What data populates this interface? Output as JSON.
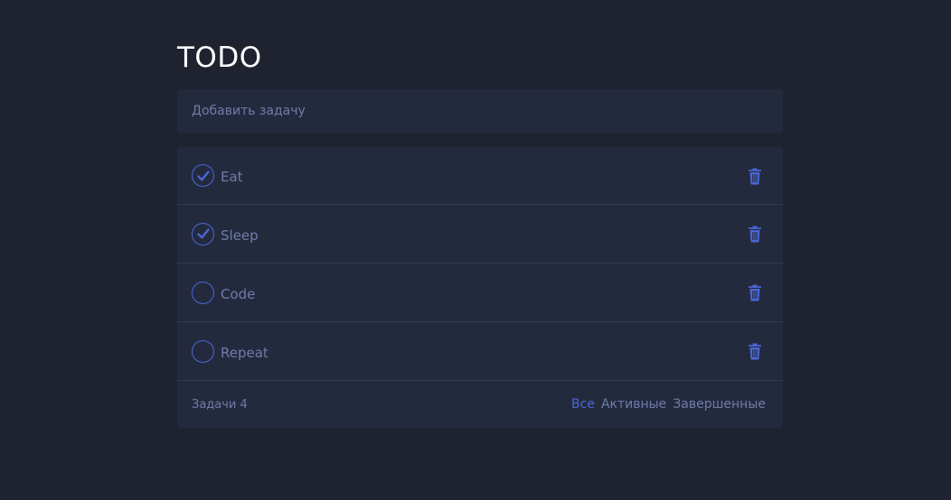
{
  "header": {
    "title": "TODO"
  },
  "new_task": {
    "placeholder": "Добавить задачу"
  },
  "todos": [
    {
      "text": "Eat",
      "done": true
    },
    {
      "text": "Sleep",
      "done": true
    },
    {
      "text": "Code",
      "done": false
    },
    {
      "text": "Repeat",
      "done": false
    }
  ],
  "footer": {
    "count_label": "Задачи 4",
    "filters": [
      {
        "label": "Все",
        "active": true
      },
      {
        "label": "Активные",
        "active": false
      },
      {
        "label": "Завершенные",
        "active": false
      }
    ]
  },
  "colors": {
    "background": "#1f2330",
    "card": "#242a3e",
    "accent": "#4a67d6",
    "muted_text": "#6f7ca8",
    "divider": "#323a55"
  },
  "icons": {
    "check": "check-icon",
    "delete": "trash-icon"
  }
}
